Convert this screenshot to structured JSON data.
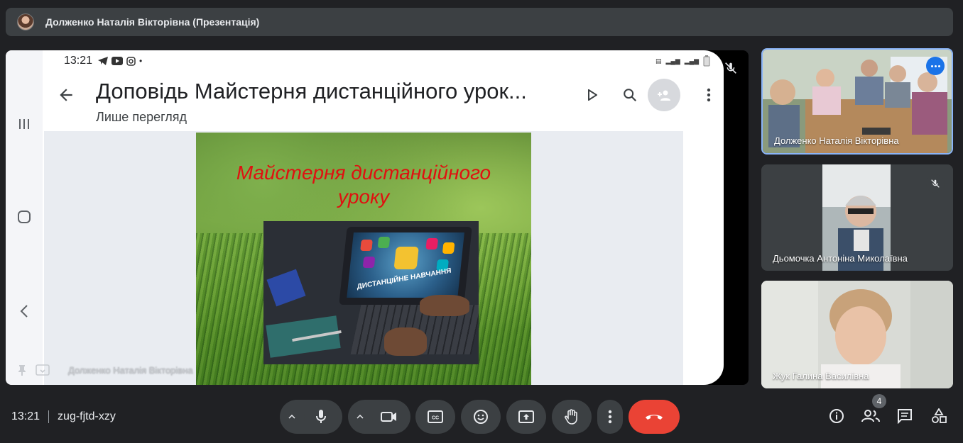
{
  "topbar": {
    "title": "Долженко Наталія Вікторівна (Презентація)"
  },
  "presentation": {
    "status_time": "13:21",
    "doc_title": "Доповідь Майстерня дистанційного урок...",
    "doc_subtitle": "Лише перегляд",
    "slide_title": "Майстерня дистанційного уроку",
    "slide_image_caption": "ДИСТАНЦІЙНЕ НАВЧАННЯ",
    "presenter_name": "Долженко Наталія Вікторівна"
  },
  "participants": [
    {
      "name": "Долженко Наталія Вікторівна",
      "muted": false,
      "active": true
    },
    {
      "name": "Дьомочка Антоніна Миколаївна",
      "muted": true,
      "active": false
    },
    {
      "name": "Жук Галина Василівна",
      "muted": false,
      "active": false
    }
  ],
  "bottombar": {
    "time": "13:21",
    "meeting_code": "zug-fjtd-xzy",
    "participant_count": "4"
  },
  "colors": {
    "background": "#202124",
    "surface": "#3c4043",
    "end_call": "#ea4335",
    "accent": "#1a73e8",
    "active_border": "#8ab4f8",
    "slide_title": "#e01010"
  },
  "icons": [
    "avatar",
    "back-arrow-icon",
    "play-icon",
    "search-icon",
    "add-person-icon",
    "more-vert-icon",
    "mic-off-icon",
    "pin-icon",
    "frame-icon",
    "mic-icon",
    "camera-icon",
    "captions-icon",
    "emoji-icon",
    "present-icon",
    "raise-hand-icon",
    "more-options-icon",
    "call-end-icon",
    "info-icon",
    "people-icon",
    "chat-icon",
    "activities-icon"
  ]
}
